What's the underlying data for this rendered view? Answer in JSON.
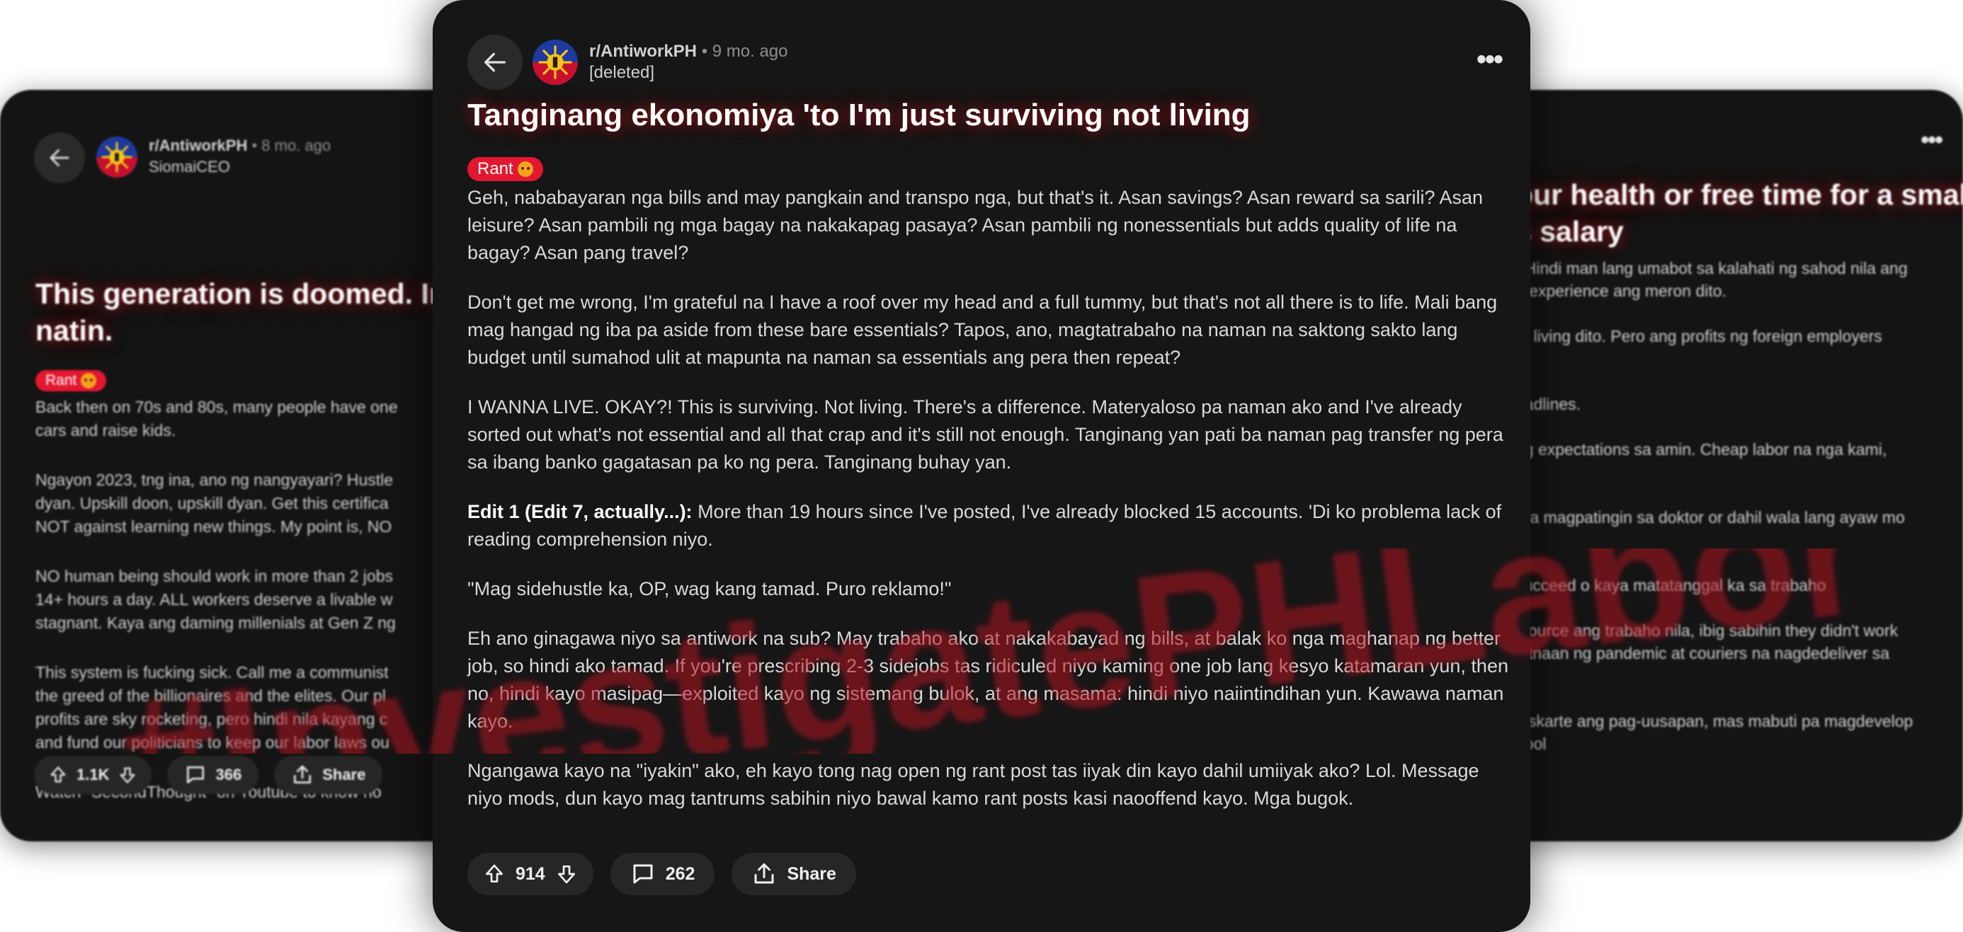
{
  "main_post": {
    "subreddit": "r/AntiworkPH",
    "time": "• 9 mo. ago",
    "author": "[deleted]",
    "title": "Tanginang ekonomiya 'to I'm just surviving not living",
    "flair": "Rant",
    "paragraphs": [
      "Geh, nababayaran nga bills and may pangkain and transpo nga, but that's it. Asan savings? Asan reward sa sarili? Asan leisure? Asan pambili ng mga bagay na nakakapag pasaya? Asan pambili ng nonessentials but adds quality of life na bagay? Asan pang travel?",
      "Don't get me wrong, I'm grateful na I have a roof over my head and a full tummy, but that's not all there is to life. Mali bang mag hangad ng iba pa aside from these bare essentials? Tapos, ano, magtatrabaho na naman na saktong sakto lang budget until sumahod ulit at mapunta na naman sa essentials ang pera then repeat?",
      "I WANNA LIVE. OKAY?! This is surviving. Not living. There's a difference. Materyaloso pa naman ako and I've already sorted out what's not essential and all that crap and it's still not enough. Tanginang yan pati ba naman pag transfer ng pera sa ibang banko gagatasan pa ko ng pera. Tanginang buhay yan."
    ],
    "edit_label": "Edit 1 (Edit 7, actually...):",
    "edit_text": " More than 19 hours since I've posted, I've already blocked 15 accounts. 'Di ko problema lack of reading comprehension niyo.",
    "paragraphs_after": [
      "\"Mag sidehustle ka, OP, wag kang tamad. Puro reklamo!\"",
      "Eh ano ginagawa niyo sa antiwork na sub? May trabaho ako at nakakabayad ng bills, at balak ko nga maghanap ng better job, so hindi ako tamad. If you're prescribing 2-3 sidejobs tas ridiculed niyo kaming one job lang kesyo katamaran yun, then no, hindi kayo masipag—exploited kayo ng sistemang bulok, at ang masama: hindi niyo naiintindihan yun. Kawawa naman kayo.",
      "Ngangawa kayo na \"iyakin\" ako, eh kayo tong nag open ng rant post tas iiyak din kayo dahil umiiyak ako? Lol. Message niyo mods, dun kayo mag tantrums sabihin niyo bawal kamo rant posts kasi naooffend kayo. Mga bugok."
    ],
    "votes": "914",
    "comments": "262",
    "share_label": "Share"
  },
  "left_post": {
    "subreddit": "r/AntiworkPH",
    "time": "• 8 mo. ago",
    "author": "SiomaiCEO",
    "title_lines": [
      "This generation is doomed. In",
      "natin."
    ],
    "flair": "Rant",
    "paragraphs": [
      [
        "Back then on 70s and 80s, many people have one",
        "cars and raise kids."
      ],
      [
        "Ngayon 2023, tng ina, ano ng nangyayari? Hustle",
        "dyan. Upskill doon, upskill dyan. Get this certifica",
        "NOT against learning new things. My point is, NO"
      ],
      [
        "NO human being should work in more than 2 jobs",
        "14+ hours a day. ALL workers deserve a livable w",
        "stagnant. Kaya ang daming millenials at Gen Z ng"
      ],
      [
        "This system is fucking sick. Call me a communist",
        "the greed of the billionaires and the elites. Our pl",
        "profits are sky rocketing, pero hindi nila kayang c",
        "and fund our politicians to keep our labor laws ou"
      ],
      [
        "Watch \"SecondThought\" on Youtube to know ho"
      ]
    ],
    "votes": "1.1K",
    "comments": "366",
    "share_label": "Share"
  },
  "right_post": {
    "title_lines": [
      "our health or free time for a small",
      "s salary"
    ],
    "lines": [
      ". Hindi man lang umabot sa kalahati ng sahod nila ang",
      "e experience ang meron dito.",
      "",
      "of living dito. Pero ang profits ng foreign employers",
      "",
      "",
      "eadlines.",
      "",
      "ng expectations sa amin. Cheap labor na nga kami,",
      "",
      "",
      "ara magpatingin sa doktor or dahil wala lang ayaw mo",
      "",
      "",
      "succeed o kaya matatanggal ka sa trabaho",
      "",
      "tsource ang trabaho nila, ibig sabihin they didn't work",
      "gitnaan ng pandemic at couriers na nagdedeliver sa",
      "",
      "",
      "diskarte ang pag-uusapan, mas mabuti pa magdevelop",
      "pool"
    ]
  },
  "overlay": {
    "hashtag": "#InvestigatePHLabor"
  },
  "colors": {
    "card_bg": "#161616",
    "flair_red": "#e41730",
    "hashtag_red": "#b0131e",
    "pill_bg": "#262626"
  }
}
